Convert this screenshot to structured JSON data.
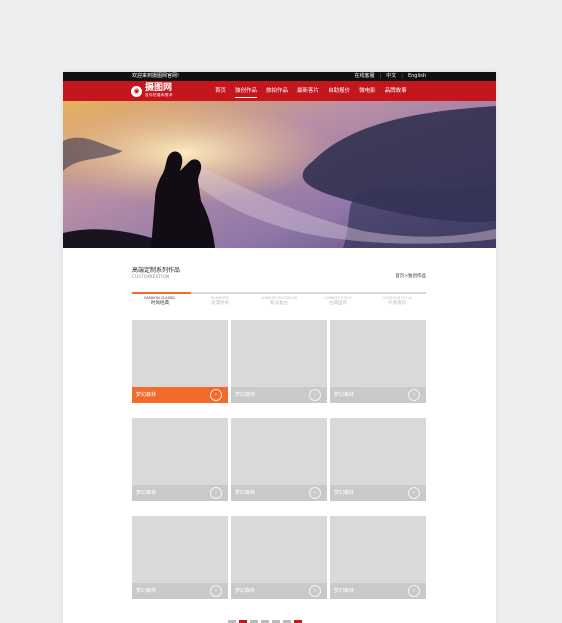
{
  "topbar": {
    "welcome": "欢迎来到摄图网官网!",
    "service": "在线客服",
    "lang_cn": "中文",
    "lang_en": "English",
    "separator": "|"
  },
  "brand": {
    "name": "摄图网",
    "tagline": "放你拍摄和需求",
    "logo_icon": "camera-icon",
    "color": "#c4161c"
  },
  "nav": {
    "items": [
      {
        "label": "首页"
      },
      {
        "label": "独创作品"
      },
      {
        "label": "旅拍作品"
      },
      {
        "label": "最新客片"
      },
      {
        "label": "自助报价"
      },
      {
        "label": "微电影"
      },
      {
        "label": "品牌故事"
      }
    ],
    "active_index": 1
  },
  "banner": {
    "image": "wedding couple silhouette at sunset"
  },
  "section": {
    "title": "高端定制系列作品",
    "subtitle": "CUSTOMIZATION",
    "breadcrumb": "首页>独创作品"
  },
  "tabs": [
    {
      "en": "FASHION CLASSIC",
      "cn": "时尚经典"
    },
    {
      "en": "ROMANTIC",
      "cn": "浪漫时尚"
    },
    {
      "en": "CHINESE NOSTALGIA",
      "cn": "新派复古"
    },
    {
      "en": "CHINESE STYLE",
      "cn": "古典国风"
    },
    {
      "en": "OUTDOOR STYLE",
      "cn": "外景清新"
    }
  ],
  "cards": [
    {
      "label": "梦幻森林"
    },
    {
      "label": "梦幻森林"
    },
    {
      "label": "梦幻森林"
    },
    {
      "label": "梦幻森林"
    },
    {
      "label": "梦幻森林"
    },
    {
      "label": "梦幻森林"
    },
    {
      "label": "梦幻森林"
    },
    {
      "label": "梦幻森林"
    },
    {
      "label": "梦幻森林"
    }
  ],
  "accent_color": "#f36a2b"
}
